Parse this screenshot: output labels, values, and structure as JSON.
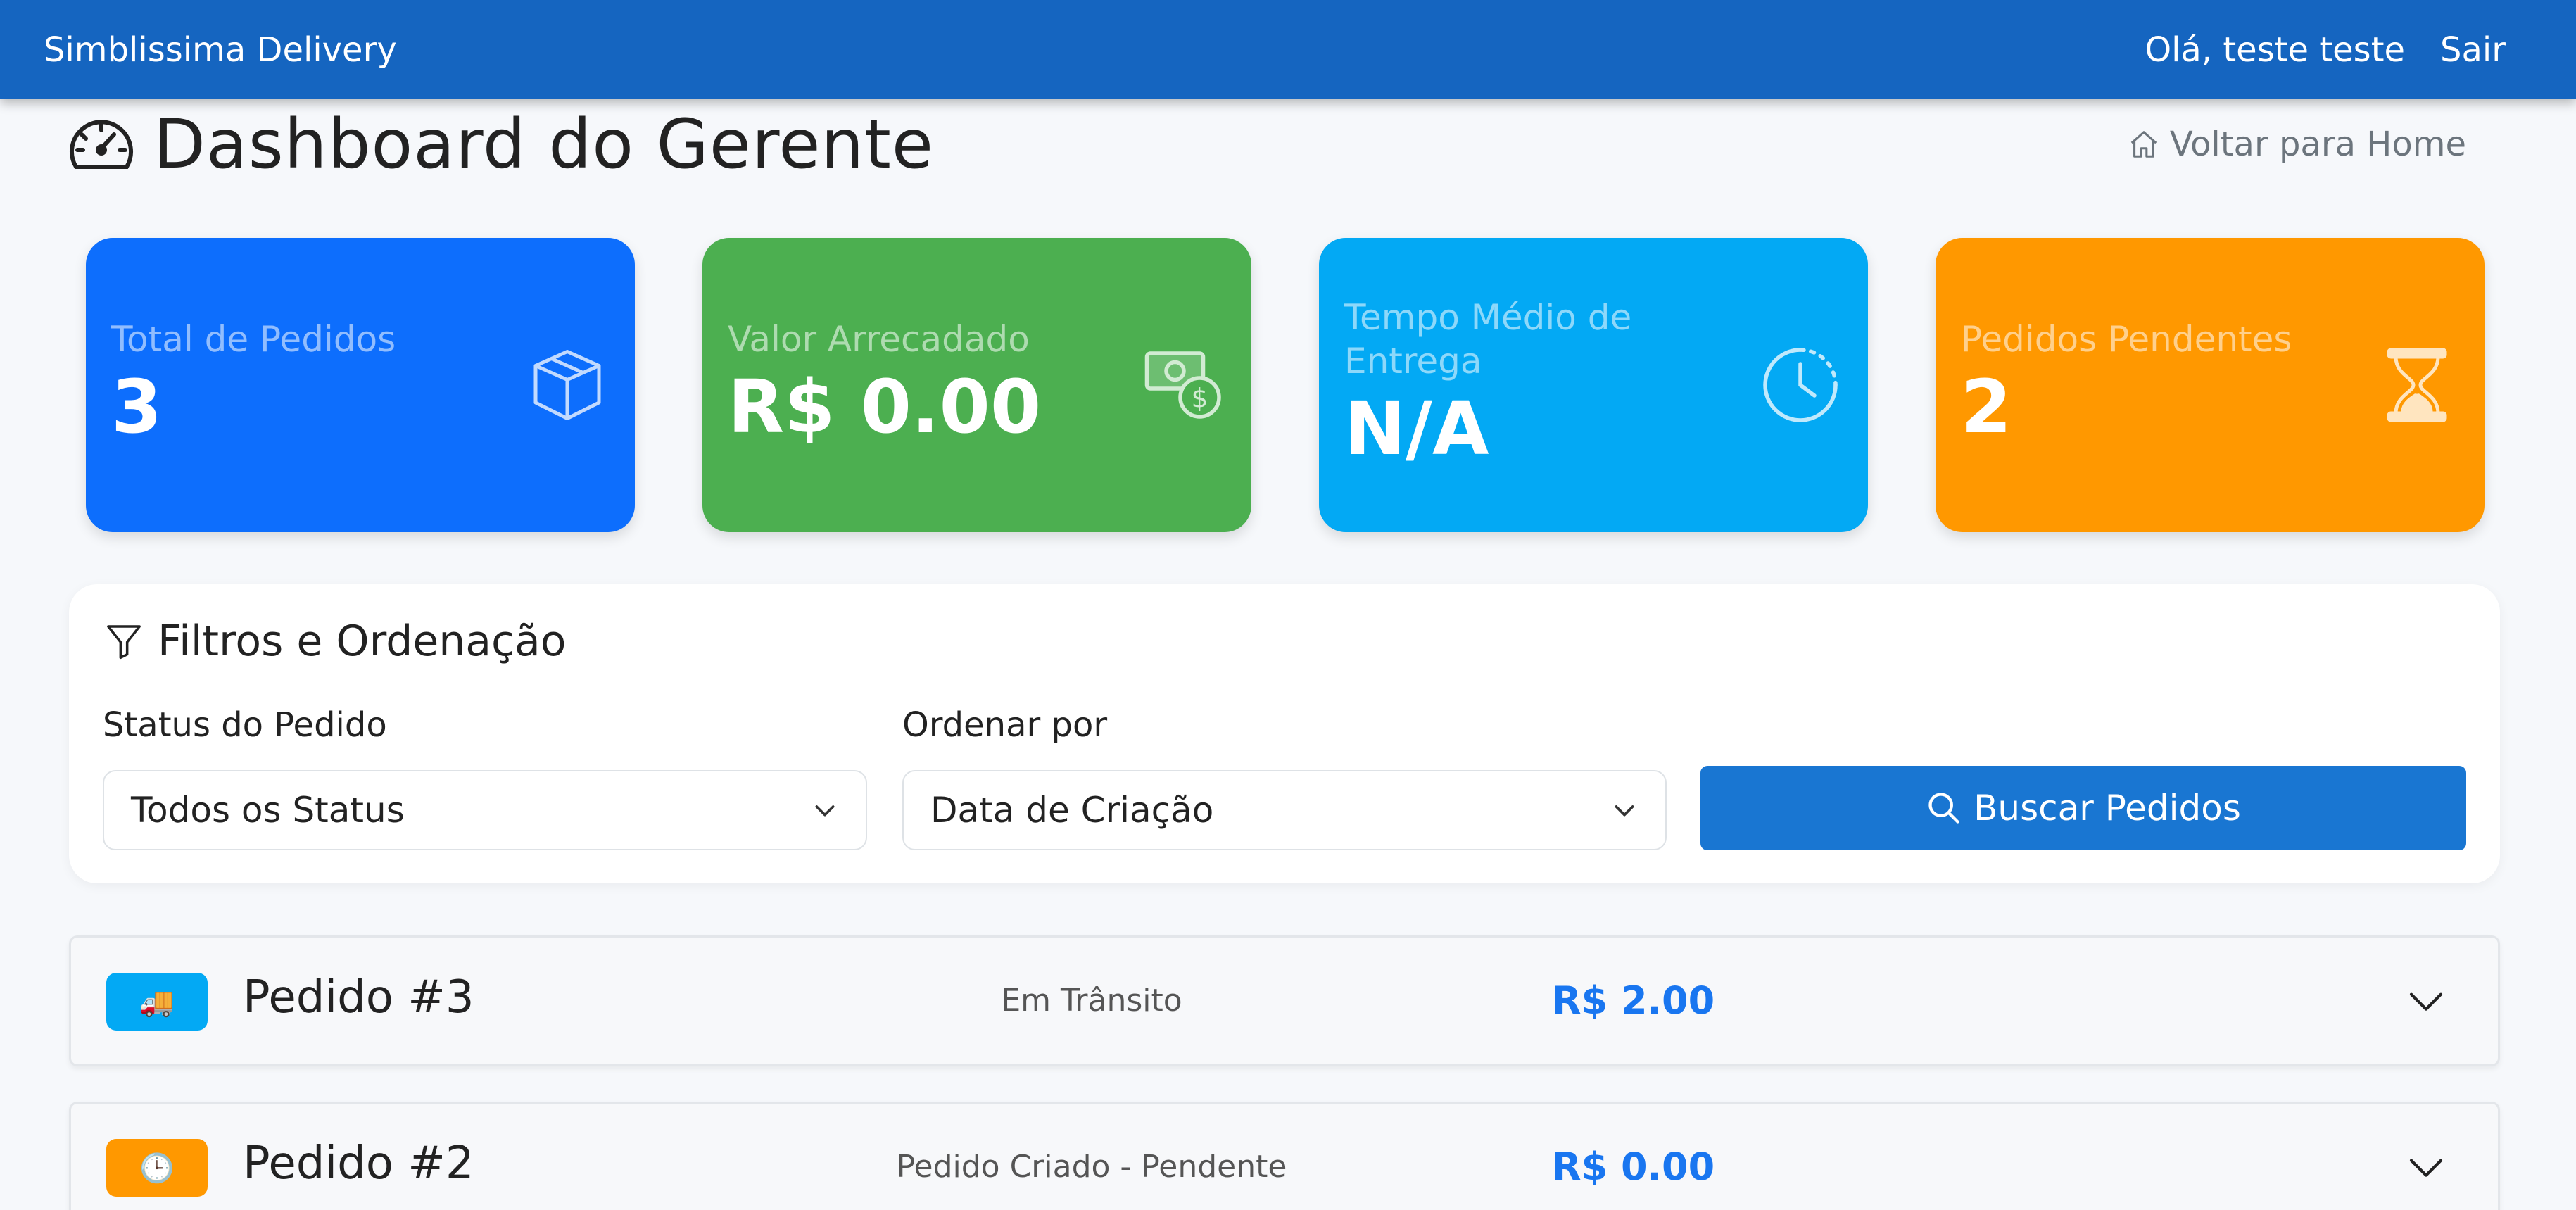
{
  "navbar": {
    "brand": "Simblissima Delivery",
    "greeting": "Olá, teste teste",
    "logout_label": "Sair",
    "background": "#1565c0"
  },
  "header": {
    "title": "Dashboard do Gerente",
    "icon": "speedometer-icon",
    "home_link_label": "Voltar para Home",
    "home_icon": "house-icon"
  },
  "stats": [
    {
      "label": "Total de Pedidos",
      "value": "3",
      "icon": "box-icon",
      "color": "#0d6efd"
    },
    {
      "label": "Valor Arrecadado",
      "value": "R$ 0.00",
      "icon": "cash-coin-icon",
      "color": "#4caf50"
    },
    {
      "label": "Tempo Médio de Entrega",
      "value": "N/A",
      "icon": "clock-icon",
      "color": "#03a9f4"
    },
    {
      "label": "Pedidos Pendentes",
      "value": "2",
      "icon": "hourglass-icon",
      "color": "#ff9800"
    }
  ],
  "filters": {
    "title": "Filtros e Ordenação",
    "icon": "funnel-icon",
    "status_label": "Status do Pedido",
    "status_value": "Todos os Status",
    "sort_label": "Ordenar por",
    "sort_value": "Data de Criação",
    "search_button": "Buscar Pedidos",
    "search_button_color": "#1976d2"
  },
  "orders": [
    {
      "title": "Pedido #3",
      "status": "Em Trânsito",
      "total": "R$ 2.00",
      "badge_icon": "🚚",
      "badge_color": "#03a9f4"
    },
    {
      "title": "Pedido #2",
      "status": "Pedido Criado - Pendente",
      "total": "R$ 0.00",
      "badge_icon": "🕒",
      "badge_color": "#ff9800"
    }
  ]
}
